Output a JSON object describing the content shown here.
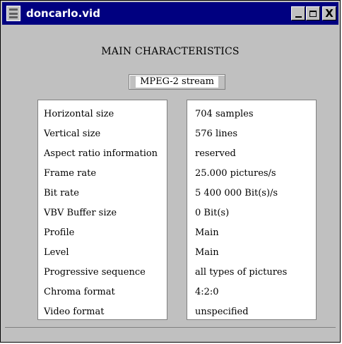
{
  "window": {
    "title": "doncarlo.vid",
    "buttons": {
      "minimize": "_",
      "maximize": "□",
      "close": "X"
    }
  },
  "heading": "MAIN CHARACTERISTICS",
  "stream_type": "MPEG-2 stream",
  "characteristics": [
    {
      "label": "Horizontal size",
      "value": "704 samples"
    },
    {
      "label": "Vertical size",
      "value": "576 lines"
    },
    {
      "label": "Aspect ratio information",
      "value": "reserved"
    },
    {
      "label": "Frame rate",
      "value": "25.000 pictures/s"
    },
    {
      "label": "Bit rate",
      "value": "5 400 000 Bit(s)/s"
    },
    {
      "label": "VBV Buffer size",
      "value": "0 Bit(s)"
    },
    {
      "label": "Profile",
      "value": "Main"
    },
    {
      "label": "Level",
      "value": "Main"
    },
    {
      "label": "Progressive sequence",
      "value": "all types of pictures"
    },
    {
      "label": "Chroma format",
      "value": "4:2:0"
    },
    {
      "label": "Video format",
      "value": "unspecified"
    }
  ]
}
